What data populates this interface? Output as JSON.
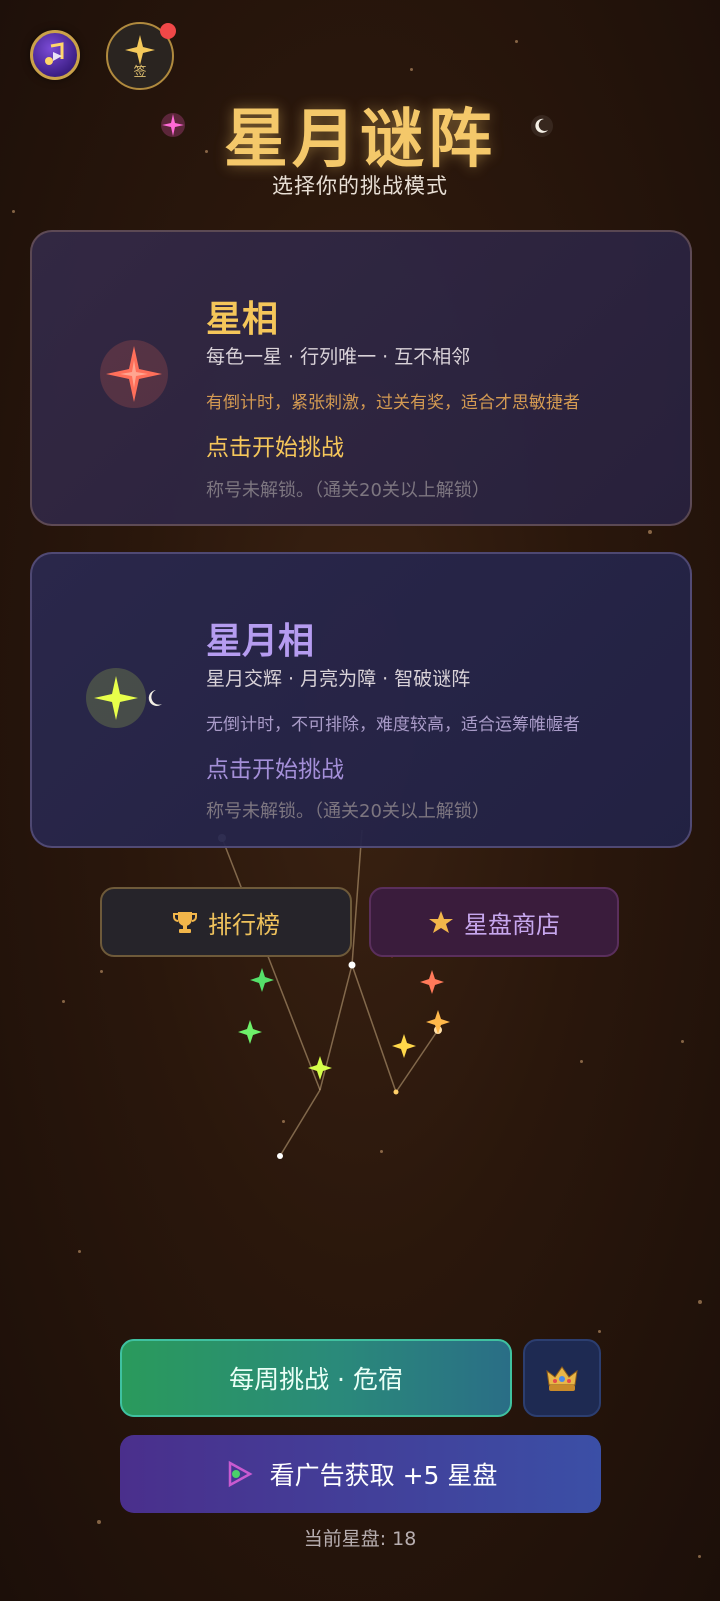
{
  "app": {
    "title": "星月谜阵",
    "subtitle": "选择你的挑战模式",
    "sign_label": "签"
  },
  "modes": [
    {
      "name": "星相",
      "rules": "每色一星 · 行列唯一 · 互不相邻",
      "note": "有倒计时，紧张刺激，过关有奖，适合才思敏捷者",
      "cta": "点击开始挑战",
      "lock": "称号未解锁。（通关20关以上解锁）",
      "accent": "#f5c65a",
      "note_color": "#d49a52"
    },
    {
      "name": "星月相",
      "rules": "星月交辉 · 月亮为障 · 智破谜阵",
      "note": "无倒计时，不可排除，难度较高，适合运筹帷幄者",
      "cta": "点击开始挑战",
      "lock": "称号未解锁。（通关20关以上解锁）",
      "accent": "#b59cf0",
      "note_color": "#a99bc8"
    }
  ],
  "buttons": {
    "rank": "排行榜",
    "shop": "星盘商店",
    "weekly": "每周挑战 · 危宿",
    "ad": "看广告获取 +5 星盘"
  },
  "balance": "当前星盘: 18",
  "icons": {
    "music": "music-note-icon",
    "sign": "sparkle-star-icon",
    "rank": "trophy-icon",
    "shop": "star-icon",
    "crown": "crown-icon",
    "ad": "play-icon"
  }
}
